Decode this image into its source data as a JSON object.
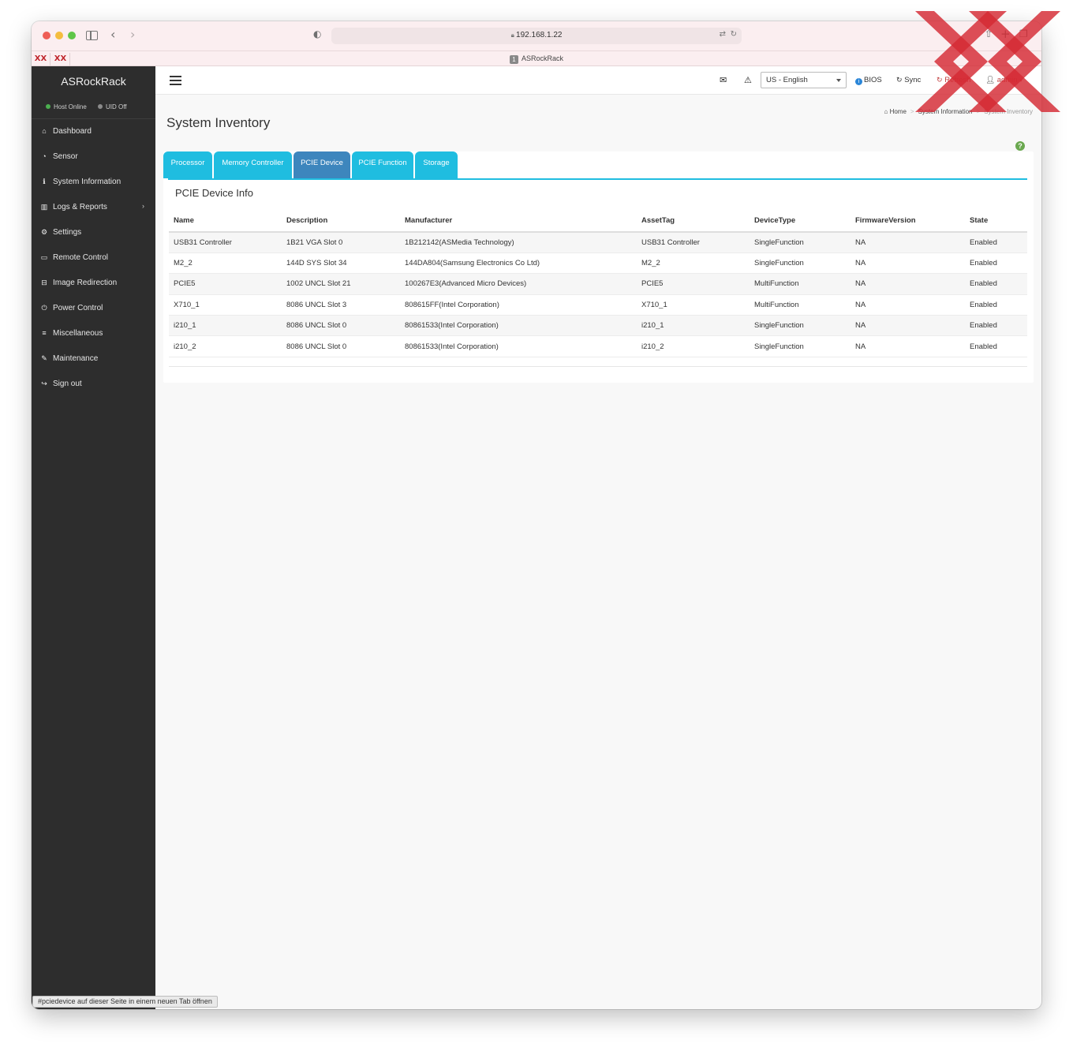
{
  "browser": {
    "url": "192.168.1.22",
    "tab_title": "ASRockRack",
    "tab_badge": "1",
    "pinned_tabs": [
      "XX",
      "XX"
    ],
    "status_link": "#pciedevice auf dieser Seite in einem neuen Tab öffnen"
  },
  "sidebar": {
    "brand": "ASRockRack",
    "host_status": "Host Online",
    "uid_status": "UID Off",
    "items": [
      {
        "label": "Dashboard",
        "icon": "home-icon"
      },
      {
        "label": "Sensor",
        "icon": "gauge-icon"
      },
      {
        "label": "System Information",
        "icon": "info-icon"
      },
      {
        "label": "Logs & Reports",
        "icon": "bar-chart-icon"
      },
      {
        "label": "Settings",
        "icon": "gear-icon"
      },
      {
        "label": "Remote Control",
        "icon": "monitor-icon"
      },
      {
        "label": "Image Redirection",
        "icon": "drive-icon"
      },
      {
        "label": "Power Control",
        "icon": "power-icon"
      },
      {
        "label": "Miscellaneous",
        "icon": "list-icon"
      },
      {
        "label": "Maintenance",
        "icon": "wrench-icon"
      },
      {
        "label": "Sign out",
        "icon": "sign-out-icon"
      }
    ]
  },
  "header": {
    "language": "US - English",
    "bios_label": "BIOS",
    "sync_label": "Sync",
    "refresh_label": "Refresh",
    "user_label": "admin"
  },
  "page": {
    "title": "System Inventory",
    "breadcrumb": [
      "Home",
      "System Information",
      "System Inventory"
    ],
    "tabs": [
      "Processor",
      "Memory Controller",
      "PCIE Device",
      "PCIE Function",
      "Storage"
    ],
    "active_tab": "PCIE Device",
    "box_title": "PCIE Device Info",
    "table": {
      "columns": [
        "Name",
        "Description",
        "Manufacturer",
        "AssetTag",
        "DeviceType",
        "FirmwareVersion",
        "State"
      ],
      "rows": [
        [
          "USB31 Controller",
          "1B21 VGA Slot 0",
          "1B212142(ASMedia Technology)",
          "USB31 Controller",
          "SingleFunction",
          "NA",
          "Enabled"
        ],
        [
          "M2_2",
          "144D SYS Slot 34",
          "144DA804(Samsung Electronics Co Ltd)",
          "M2_2",
          "SingleFunction",
          "NA",
          "Enabled"
        ],
        [
          "PCIE5",
          "1002 UNCL Slot 21",
          "100267E3(Advanced Micro Devices)",
          "PCIE5",
          "MultiFunction",
          "NA",
          "Enabled"
        ],
        [
          "X710_1",
          "8086 UNCL Slot 3",
          "808615FF(Intel Corporation)",
          "X710_1",
          "MultiFunction",
          "NA",
          "Enabled"
        ],
        [
          "i210_1",
          "8086 UNCL Slot 0",
          "80861533(Intel Corporation)",
          "i210_1",
          "SingleFunction",
          "NA",
          "Enabled"
        ],
        [
          "i210_2",
          "8086 UNCL Slot 0",
          "80861533(Intel Corporation)",
          "i210_2",
          "SingleFunction",
          "NA",
          "Enabled"
        ]
      ]
    }
  },
  "colors": {
    "tab": "#1fbde0",
    "tab_active": "#3d86bd",
    "sidebar": "#2d2d2d",
    "status_online": "#4caf50",
    "status_uid": "#8a8a8a",
    "watermark": "#d42a33"
  }
}
